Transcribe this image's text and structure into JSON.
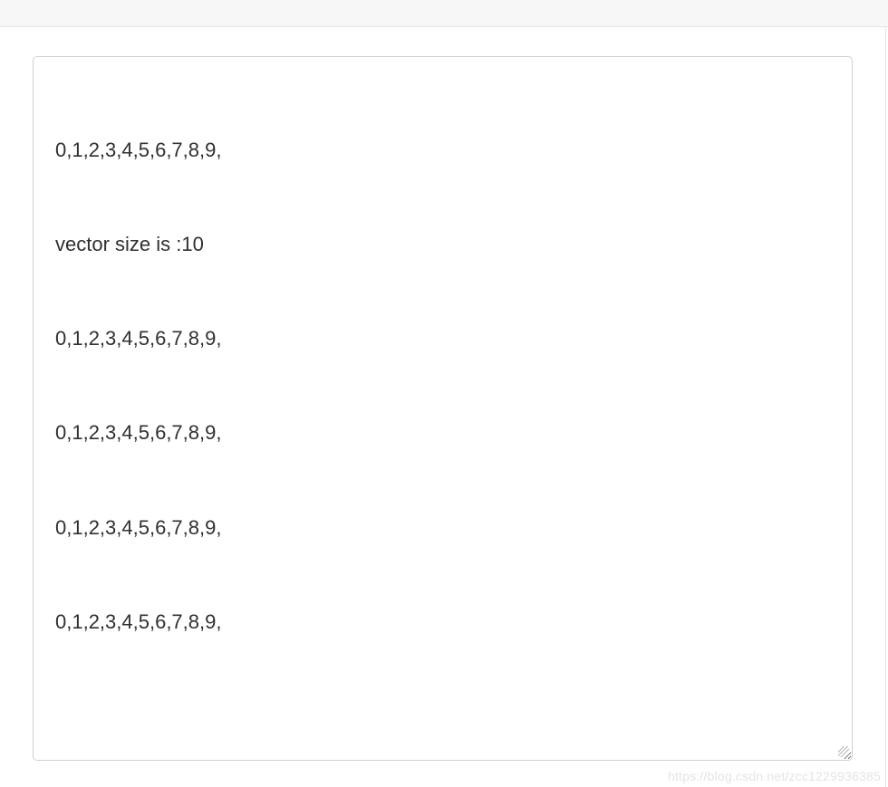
{
  "output": {
    "lines": [
      "0,1,2,3,4,5,6,7,8,9,",
      "vector size is :10",
      "0,1,2,3,4,5,6,7,8,9,",
      "0,1,2,3,4,5,6,7,8,9,",
      "0,1,2,3,4,5,6,7,8,9,",
      "0,1,2,3,4,5,6,7,8,9,"
    ]
  },
  "watermark": "https://blog.csdn.net/zcc1229936385"
}
